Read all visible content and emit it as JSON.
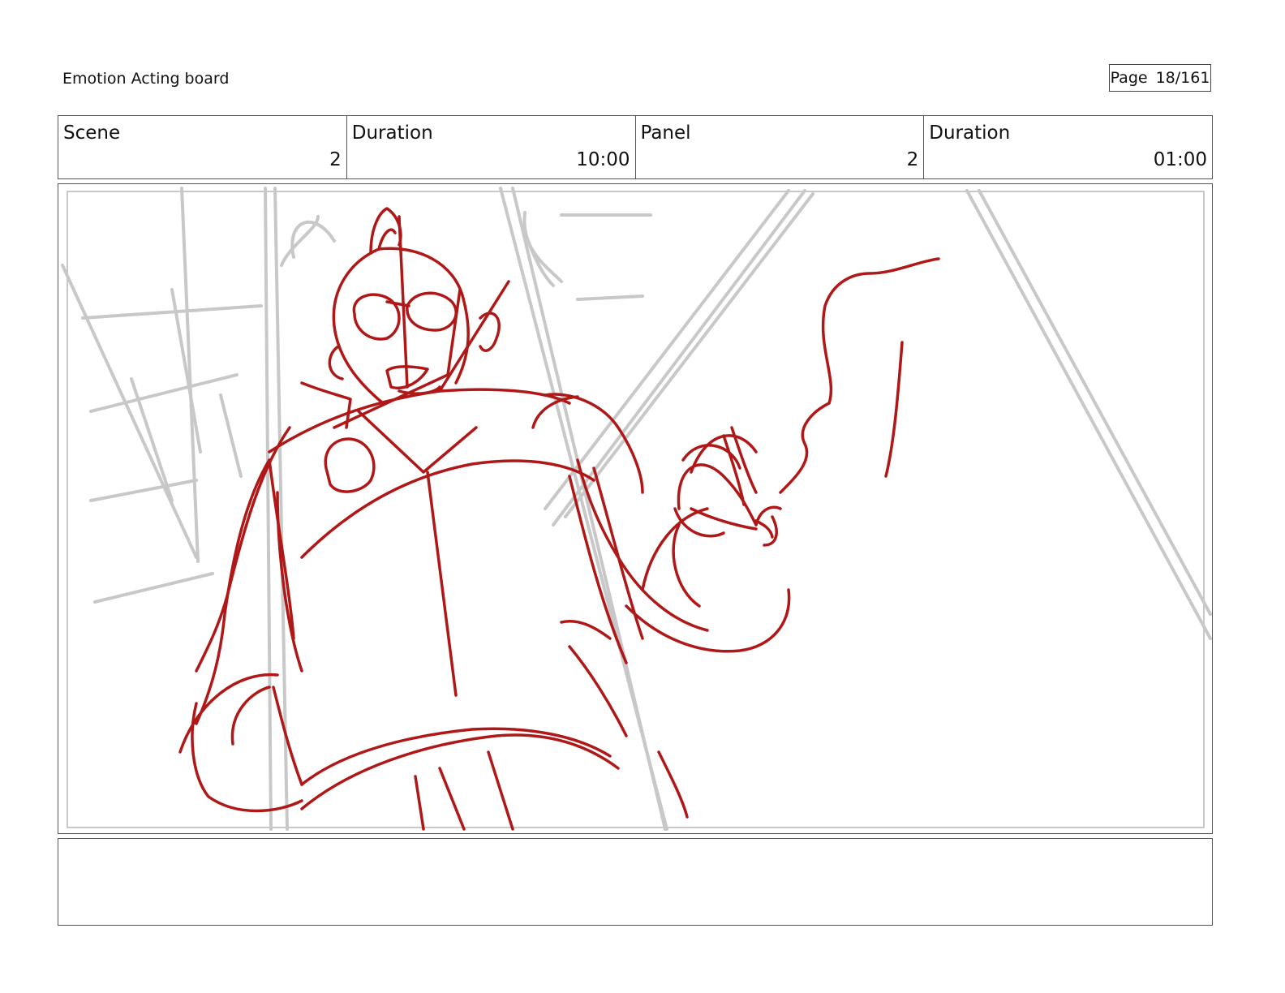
{
  "header": {
    "title": "Emotion Acting board",
    "page_label": "Page",
    "page_number": "18/161"
  },
  "info_row": [
    {
      "label": "Scene",
      "value": "2"
    },
    {
      "label": "Duration",
      "value": "10:00"
    },
    {
      "label": "Panel",
      "value": "2"
    },
    {
      "label": "Duration",
      "value": "01:00"
    }
  ],
  "panel": {
    "sketch_subject": "character-sketch",
    "colors": {
      "rough": "#c8c8c8",
      "ink": "#b01818"
    }
  },
  "notes": {
    "text": ""
  }
}
